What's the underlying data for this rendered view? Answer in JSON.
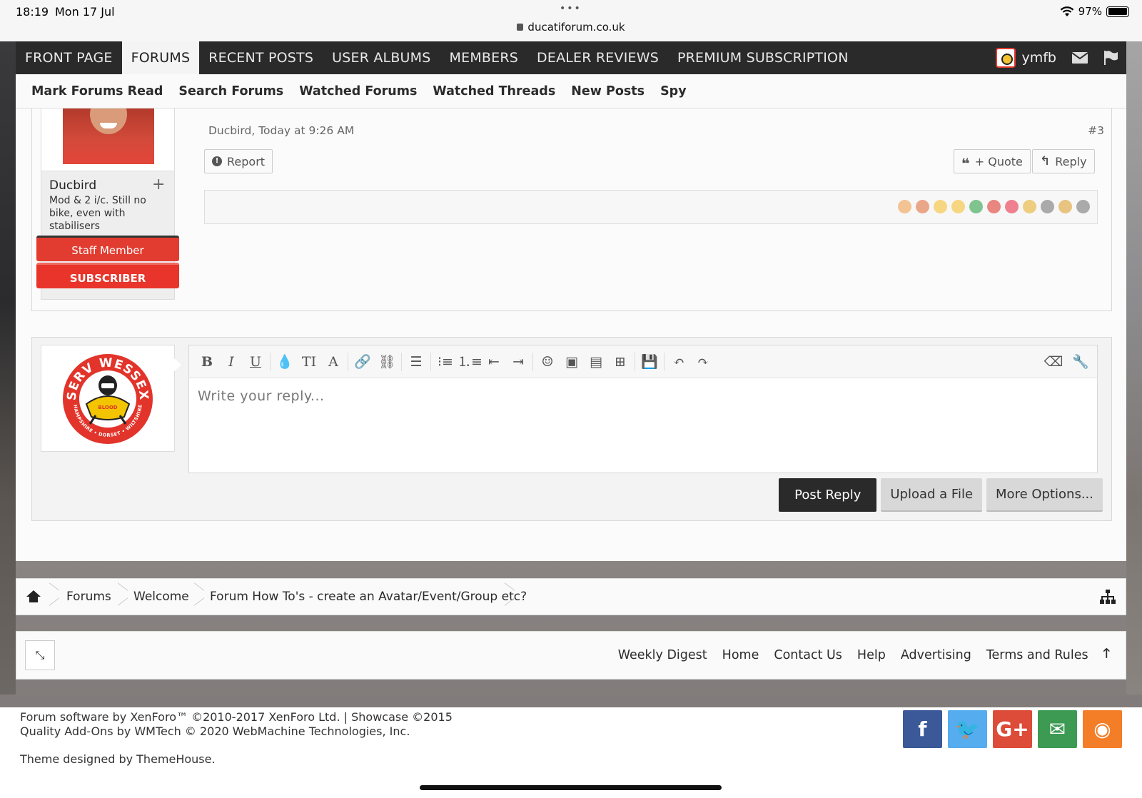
{
  "status_bar": {
    "time": "18:19",
    "date": "Mon 17 Jul",
    "url": "ducatiforum.co.uk",
    "battery": "97%",
    "battery_level": 0.97
  },
  "main_nav": {
    "tabs": [
      {
        "label": "FRONT PAGE",
        "active": false
      },
      {
        "label": "FORUMS",
        "active": true
      },
      {
        "label": "RECENT POSTS",
        "active": false
      },
      {
        "label": "USER ALBUMS",
        "active": false
      },
      {
        "label": "MEMBERS",
        "active": false
      },
      {
        "label": "DEALER REVIEWS",
        "active": false
      },
      {
        "label": "PREMIUM SUBSCRIPTION",
        "active": false
      }
    ],
    "username": "ymfb"
  },
  "sub_nav": {
    "links": [
      "Mark Forums Read",
      "Search Forums",
      "Watched Forums",
      "Watched Threads",
      "New Posts",
      "Spy"
    ]
  },
  "post": {
    "author": "Ducbird",
    "user_title": "Mod & 2 i/c. Still no bike, even with stabilisers",
    "badge_staff": "Staff Member",
    "badge_subscriber": "SUBSCRIBER",
    "meta": "Ducbird, Today at 9:26 AM",
    "number": "#3",
    "report_label": "Report",
    "quote_label": "+ Quote",
    "reply_label": "Reply",
    "reaction_colors": [
      "#f0a050",
      "#e07040",
      "#f5c030",
      "#f5c030",
      "#2ea04a",
      "#e03a2f",
      "#e8304a",
      "#e8b030",
      "#777777",
      "#e0a030",
      "#777777"
    ]
  },
  "editor": {
    "placeholder": "Write your reply...",
    "post_reply": "Post Reply",
    "upload": "Upload a File",
    "more_options": "More Options..."
  },
  "logo": {
    "top_text": "SERV WESSEX",
    "bottom_text": "HAMPSHIRE • DORSET • WILTSHIRE",
    "center_text": "BLOOD"
  },
  "breadcrumb": [
    "Forums",
    "Welcome",
    "Forum How To's - create an Avatar/Event/Group etc?"
  ],
  "footer_links": [
    "Weekly Digest",
    "Home",
    "Contact Us",
    "Help",
    "Advertising",
    "Terms and Rules"
  ],
  "copyright": {
    "line1": "Forum software by XenForo™ ©2010-2017 XenForo Ltd. | Showcase ©2015",
    "line2": "Quality Add-Ons by WMTech © 2020 WebMachine Technologies, Inc.",
    "line3": "Theme designed by ThemeHouse."
  },
  "socials": [
    {
      "icon": "facebook-icon",
      "glyph": "f",
      "color": "#3b5998"
    },
    {
      "icon": "twitter-icon",
      "glyph": "🐦",
      "color": "#55acee"
    },
    {
      "icon": "google-plus-icon",
      "glyph": "G+",
      "color": "#dd4b39"
    },
    {
      "icon": "email-icon",
      "glyph": "✉",
      "color": "#3c9a52"
    },
    {
      "icon": "rss-icon",
      "glyph": "◉",
      "color": "#f47d28"
    }
  ]
}
